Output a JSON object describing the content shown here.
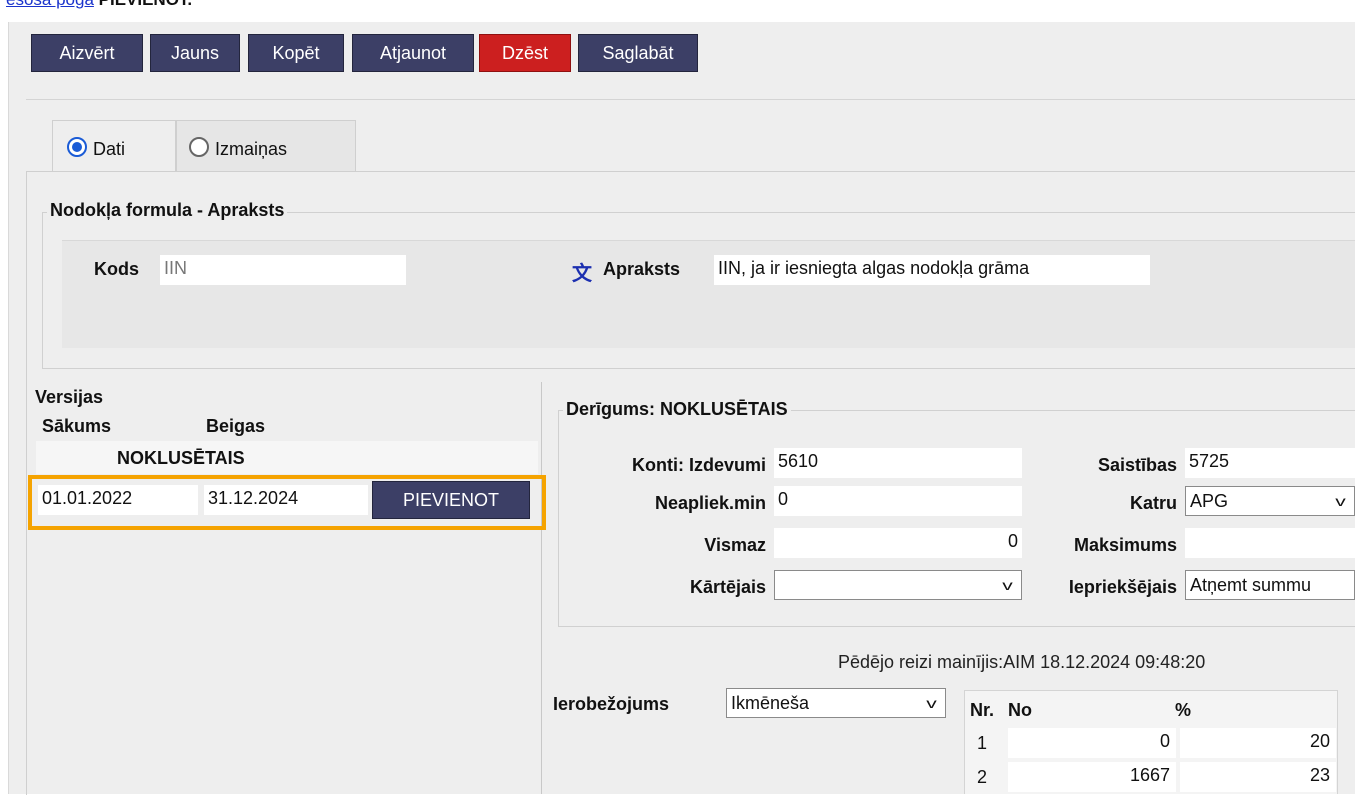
{
  "top_link": {
    "link_text": "esošā pogā",
    "rest": " PIEVIENOT."
  },
  "toolbar": {
    "close": "Aizvērt",
    "new": "Jauns",
    "copy": "Kopēt",
    "refresh": "Atjaunot",
    "delete": "Dzēst",
    "save": "Saglabāt",
    "delete_color": "#cc1f1f",
    "button_color": "#3c3f66"
  },
  "tabs": [
    {
      "label": "Dati",
      "selected": true
    },
    {
      "label": "Izmaiņas",
      "selected": false
    }
  ],
  "header_section": {
    "legend": "Nodokļa formula - Apraksts",
    "kods_label": "Kods",
    "kods_value": "IIN",
    "translate_icon": "文",
    "apraksts_label": "Apraksts",
    "apraksts_value": "IIN, ja ir iesniegta algas nodokļa grāma"
  },
  "versions": {
    "title": "Versijas",
    "col_start": "Sākums",
    "col_end": "Beigas",
    "group": "NOKLUSĒTAIS",
    "start_value": "01.01.2022",
    "end_value": "31.12.2024",
    "add_button": "PIEVIENOT",
    "highlight_color": "#f5a300"
  },
  "validity": {
    "legend": "Derīgums: NOKLUSĒTAIS",
    "konti_label": "Konti: Izdevumi",
    "konti_value": "5610",
    "saistibas_label": "Saistības",
    "saistibas_value": "5725",
    "neapl_label": "Neapliek.min",
    "neapl_value": "0",
    "katru_label": "Katru",
    "katru_value": "APG",
    "vismaz_label": "Vismaz",
    "vismaz_value": "0",
    "max_label": "Maksimums",
    "max_value": "",
    "kartejais_label": "Kārtējais",
    "kartejais_value": "",
    "ieprieksejais_label": "Iepriekšējais",
    "ieprieksejais_value": "Atņemt summu"
  },
  "last_changed": "Pēdējo reizi mainījis:AIM 18.12.2024 09:48:20",
  "limit": {
    "label": "Ierobežojums",
    "value": "Ikmēneša",
    "col_nr": "Nr.",
    "col_no": "No",
    "col_pct": "%",
    "rows": [
      {
        "nr": "1",
        "no": "0",
        "pct": "20"
      },
      {
        "nr": "2",
        "no": "1667",
        "pct": "23"
      }
    ]
  }
}
